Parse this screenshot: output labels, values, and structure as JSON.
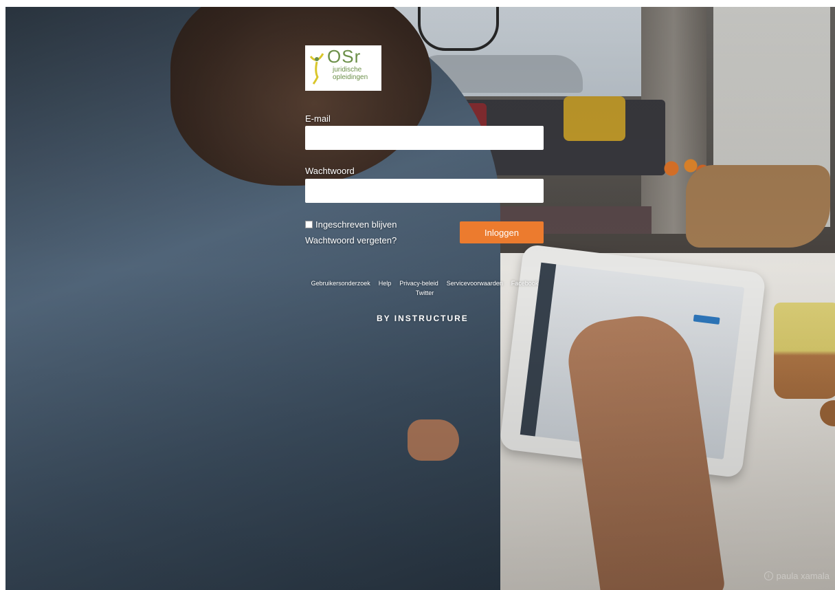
{
  "logo": {
    "brand": "OSr",
    "subtitle_line1": "juridische",
    "subtitle_line2": "opleidingen",
    "color": "#6b8f48"
  },
  "form": {
    "email_label": "E-mail",
    "email_value": "",
    "password_label": "Wachtwoord",
    "password_value": "",
    "remember_label": "Ingeschreven blijven",
    "remember_checked": false,
    "forgot_label": "Wachtwoord vergeten?",
    "login_label": "Inloggen",
    "login_color": "#ec7b2e"
  },
  "footer": {
    "links": [
      "Gebruikersonderzoek",
      "Help",
      "Privacy-beleid",
      "Servicevoorwaarden",
      "Facebook",
      "Twitter"
    ],
    "by_instructure": "BY INSTRUCTURE"
  },
  "credit": {
    "icon": "info-icon",
    "text": "paula xamala"
  }
}
